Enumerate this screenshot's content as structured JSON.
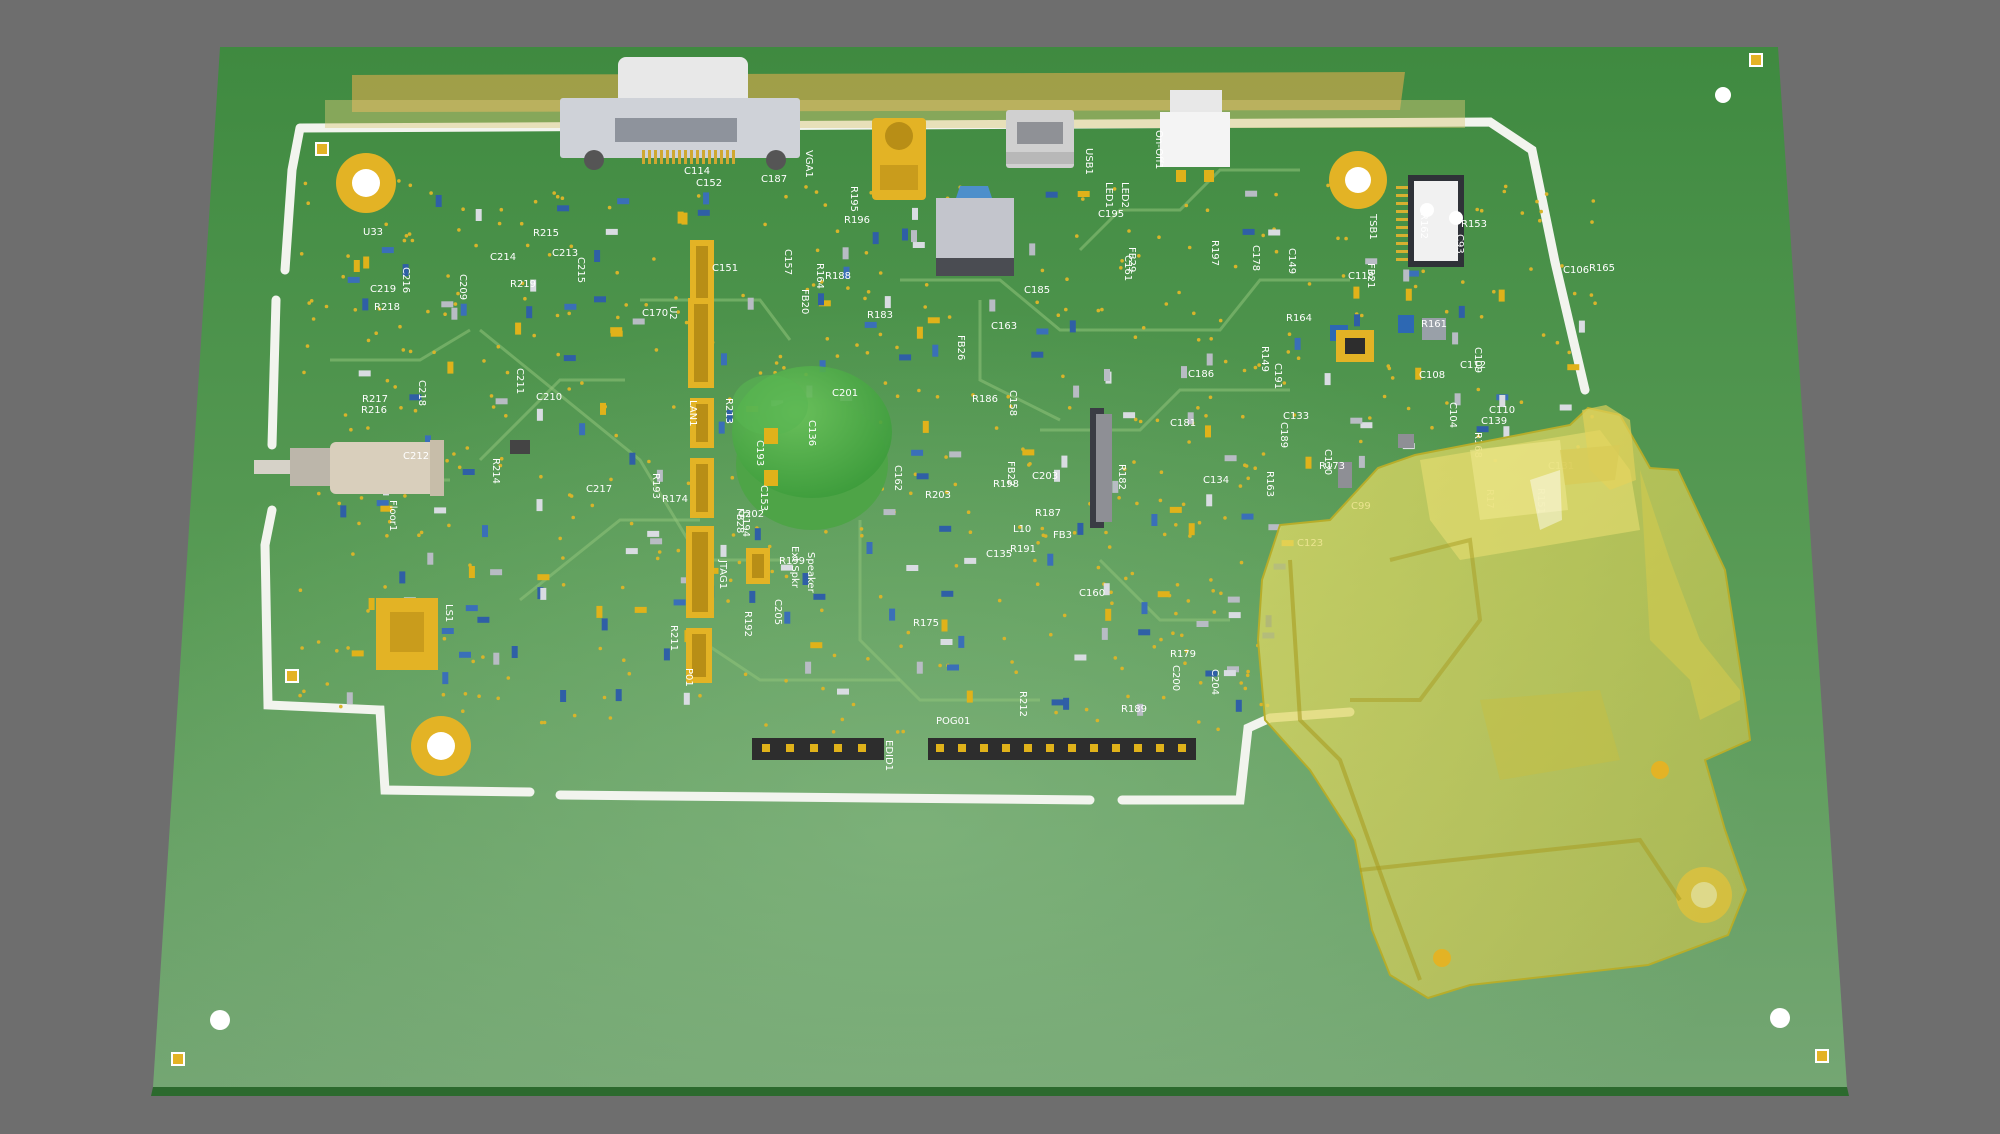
{
  "colors": {
    "background": "#6e6e6e",
    "board": "#4c8d48",
    "board_edge": "#2f6e32",
    "silkscreen": "#ffffff",
    "copper_pad": "#e0b21a",
    "translucent_enclosure": "#d9d35a"
  },
  "designators": {
    "left": [
      "R219",
      "R218",
      "R217",
      "C217",
      "C215",
      "C214",
      "C213",
      "R216",
      "C219",
      "C218",
      "C216",
      "C212",
      "C210",
      "R215",
      "R214",
      "U33",
      "C211",
      "C209"
    ],
    "connectors": [
      "VGA1",
      "USB1",
      "LED1",
      "LED2",
      "On-Off1",
      "TSB1",
      "Floor1",
      "LS1",
      "Ext Spkr",
      "Speaker",
      "JTAG1",
      "POG01",
      "EDID1",
      "P01",
      "LAN1"
    ],
    "center": [
      "C203",
      "C204",
      "C205",
      "R213",
      "R212",
      "R211",
      "FB3",
      "C201",
      "C200",
      "R203",
      "C202",
      "C195",
      "R199",
      "C193",
      "C191",
      "C189",
      "FB29",
      "C178",
      "C181",
      "C185",
      "C186",
      "C187",
      "R191",
      "R192",
      "R188",
      "R189",
      "FB26",
      "FB28",
      "C194",
      "R198",
      "R197",
      "R195",
      "R196",
      "C170",
      "C163",
      "C160",
      "C158",
      "C157",
      "R187",
      "R186",
      "R193",
      "R164",
      "C161",
      "C162",
      "C151",
      "C152",
      "C153",
      "R182",
      "R183",
      "C136",
      "C133",
      "C134",
      "C135",
      "C123",
      "C114",
      "FB20",
      "FB22",
      "L10",
      "U2",
      "R175",
      "R174",
      "R179"
    ],
    "right": [
      "R163",
      "R161",
      "R165",
      "R162",
      "R164",
      "C93",
      "C99",
      "C104",
      "C106",
      "C112",
      "C118",
      "C131",
      "C139",
      "C130",
      "FB21",
      "R173",
      "R168",
      "R17",
      "C108",
      "C109",
      "C110",
      "R151",
      "R153",
      "C149",
      "R149"
    ]
  }
}
